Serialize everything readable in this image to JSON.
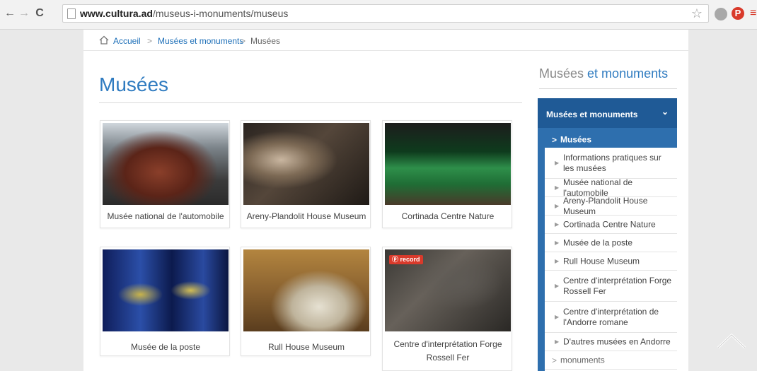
{
  "browser": {
    "url_host": "www.cultura.ad",
    "url_path": "/museus-i-monuments/museus",
    "nav_back": "←",
    "nav_forward": "→",
    "nav_reload": "C",
    "star_icon": "☆",
    "ext_pinterest": "P"
  },
  "breadcrumb": {
    "home": "Accueil",
    "separator": ">",
    "level1": "Musées et monuments",
    "current": "Musées"
  },
  "main": {
    "title": "Musées",
    "cards": [
      {
        "label": "Musée national de l'automobile"
      },
      {
        "label": "Areny-Plandolit House Museum"
      },
      {
        "label": "Cortinada Centre Nature"
      },
      {
        "label": "Musée de la poste"
      },
      {
        "label": "Rull House Museum"
      },
      {
        "label": "Centre d'interprétation Forge Rossell Fer",
        "badge": "ⓟ record"
      }
    ]
  },
  "sidebar": {
    "title_plain": "Musées",
    "title_accent": "et monuments",
    "menu_header": "Musées et monuments",
    "items": [
      {
        "label": "Musées",
        "marker": ">"
      },
      {
        "label": "Informations pratiques sur les musées",
        "marker": "▶"
      },
      {
        "label": "Musée national de l'automobile",
        "marker": "▶"
      },
      {
        "label": "Areny-Plandolit House Museum",
        "marker": "▶"
      },
      {
        "label": "Cortinada Centre Nature",
        "marker": "▶"
      },
      {
        "label": "Musée de la poste",
        "marker": "▶"
      },
      {
        "label": "Rull House Museum",
        "marker": "▶"
      },
      {
        "label": "Centre d'interprétation Forge Rossell Fer",
        "marker": "▶"
      },
      {
        "label": "Centre d'interprétation de l'Andorre romane",
        "marker": "▶"
      },
      {
        "label": "D'autres musées en Andorre",
        "marker": "▶"
      },
      {
        "label": "monuments",
        "marker": ">"
      }
    ]
  },
  "colors": {
    "link": "#1d6fb8",
    "title_blue": "#2f7bc0",
    "menu_blue": "#2e6fae",
    "menu_header_blue": "#1f5a96",
    "pinterest_red": "#d93a2b"
  }
}
